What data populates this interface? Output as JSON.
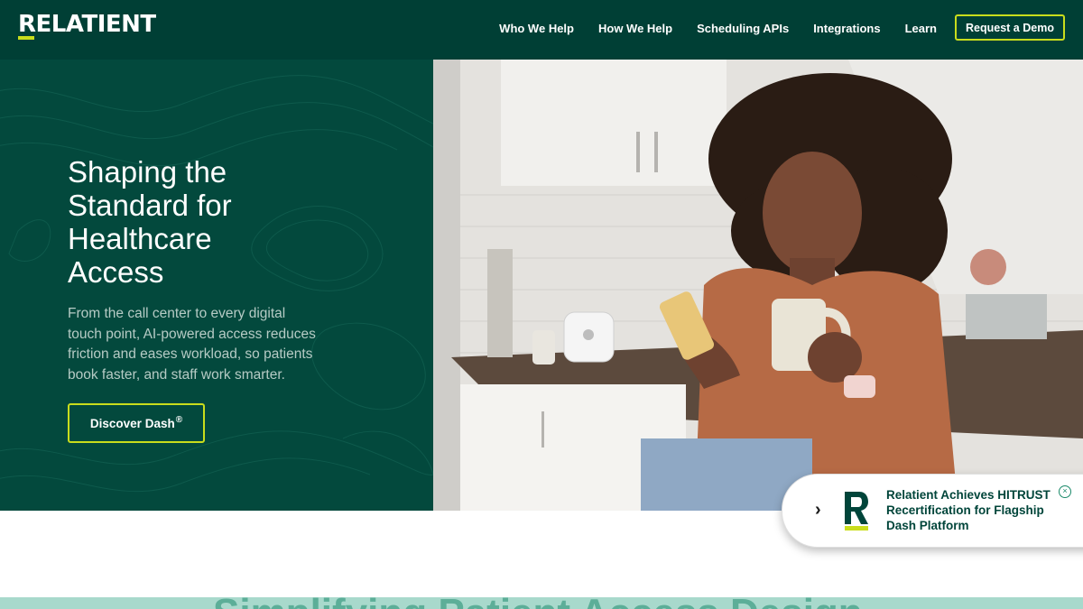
{
  "brand": {
    "name": "RELATIENT",
    "accent": "#c9dd1c",
    "primary": "#003f35"
  },
  "nav": {
    "items": [
      "Who We Help",
      "How We Help",
      "Scheduling APIs",
      "Integrations",
      "Learn"
    ],
    "cta": "Request a Demo"
  },
  "hero": {
    "headline": "Shaping the Standard for Healthcare Access",
    "subtext": "From the call center to every digital touch point, AI-powered access reduces friction and eases workload, so patients book faster, and staff work smarter.",
    "button_label": "Discover Dash",
    "button_mark": "®",
    "image_icon": "woman-with-phone-and-mug-photo"
  },
  "toast": {
    "text": "Relatient Achieves HITRUST Recertification for Flagship Dash Platform",
    "logo_letter": "R",
    "arrow_icon": "chevron-right-icon",
    "close_icon": "close-circle-icon"
  },
  "section": {
    "heading_partial": "Simplifying Patient Access Design"
  }
}
